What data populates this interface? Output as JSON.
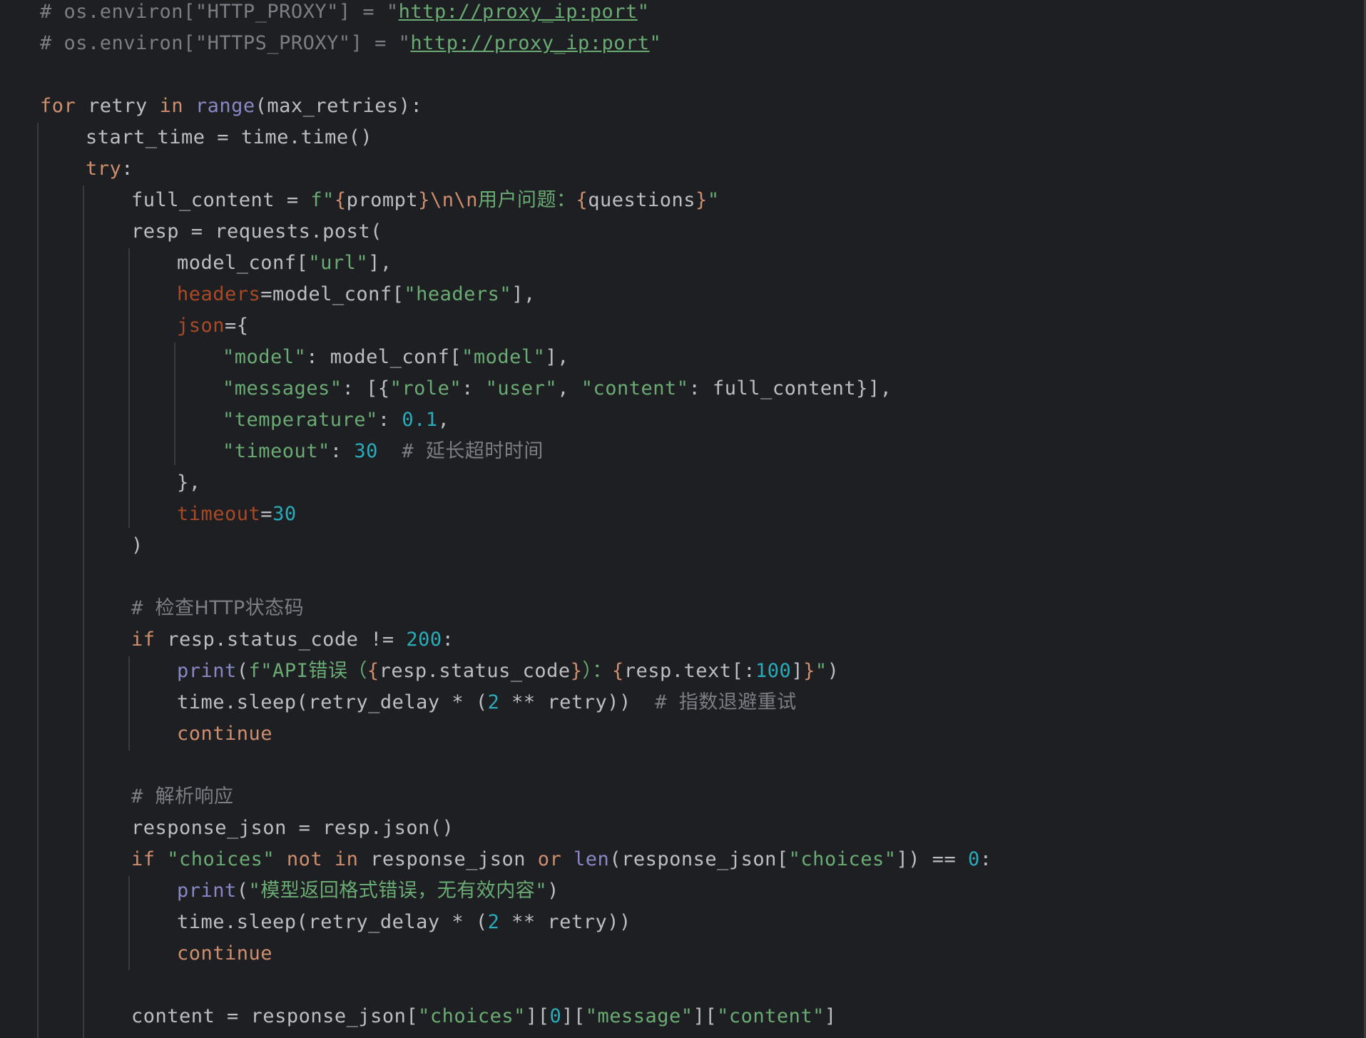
{
  "colors": {
    "background": "#1e1f22",
    "text": "#bcbec4",
    "comment": "#7a7e85",
    "keyword": "#cf8e6d",
    "builtin": "#8888c6",
    "string": "#6aab73",
    "number": "#2aacb8",
    "parameter": "#aa4926",
    "indent_guide": "#393b40"
  },
  "code": {
    "l1": {
      "a": "# os.environ[\"HTTP_PROXY\"] = \"",
      "b": "http://proxy_ip:port",
      "c": "\""
    },
    "l2": {
      "a": "# os.environ[\"HTTPS_PROXY\"] = \"",
      "b": "http://proxy_ip:port",
      "c": "\""
    },
    "l4": {
      "a": "for",
      "b": " retry ",
      "c": "in",
      "d": " ",
      "e": "range",
      "f": "(max_retries):"
    },
    "l5": {
      "a": "start_time = time.time()"
    },
    "l6": {
      "a": "try",
      "b": ":"
    },
    "l7": {
      "a": "full_content = ",
      "b": "f\"",
      "c": "{",
      "d": "prompt",
      "e": "}",
      "f": "\\n\\n",
      "g": "用户问题：",
      "h": "{",
      "i": "questions",
      "j": "}",
      "k": "\""
    },
    "l8": {
      "a": "resp = requests.post("
    },
    "l9": {
      "a": "model_conf[",
      "b": "\"url\"",
      "c": "],"
    },
    "l10": {
      "a": "headers",
      "b": "=model_conf[",
      "c": "\"headers\"",
      "d": "],"
    },
    "l11": {
      "a": "json",
      "b": "={"
    },
    "l12": {
      "a": "\"model\"",
      "b": ": model_conf[",
      "c": "\"model\"",
      "d": "],"
    },
    "l13": {
      "a": "\"messages\"",
      "b": ": [{",
      "c": "\"role\"",
      "d": ": ",
      "e": "\"user\"",
      "f": ", ",
      "g": "\"content\"",
      "h": ": full_content}],"
    },
    "l14": {
      "a": "\"temperature\"",
      "b": ": ",
      "c": "0.1",
      "d": ","
    },
    "l15": {
      "a": "\"timeout\"",
      "b": ": ",
      "c": "30",
      "d": "  # ",
      "e": "延长超时时间"
    },
    "l16": {
      "a": "},"
    },
    "l17": {
      "a": "timeout",
      "b": "=",
      "c": "30"
    },
    "l18": {
      "a": ")"
    },
    "l20": {
      "a": "# ",
      "b": "检查HTTP状态码"
    },
    "l21": {
      "a": "if",
      "b": " resp.status_code != ",
      "c": "200",
      "d": ":"
    },
    "l22": {
      "a": "print",
      "b": "(",
      "c": "f\"API",
      "d": "错误（",
      "e": "{",
      "f": "resp.status_code",
      "g": "}",
      "h": "）：",
      "i": "{",
      "j": "resp.text[:",
      "k": "100",
      "l": "]",
      "m": "}",
      "n": "\"",
      "o": ")"
    },
    "l23": {
      "a": "time.sleep(retry_delay * (",
      "b": "2",
      "c": " ** retry))  ",
      "d": "# ",
      "e": "指数退避重试"
    },
    "l24": {
      "a": "continue"
    },
    "l26": {
      "a": "# ",
      "b": "解析响应"
    },
    "l27": {
      "a": "response_json = resp.json()"
    },
    "l28": {
      "a": "if",
      "b": " ",
      "c": "\"choices\"",
      "d": " ",
      "e": "not",
      "f": " ",
      "g": "in",
      "h": " response_json ",
      "i": "or",
      "j": " ",
      "k": "len",
      "l": "(response_json[",
      "m": "\"choices\"",
      "n": "]) == ",
      "o": "0",
      "p": ":"
    },
    "l29": {
      "a": "print",
      "b": "(",
      "c": "\"",
      "d": "模型返回格式错误，无有效内容",
      "e": "\"",
      "f": ")"
    },
    "l30": {
      "a": "time.sleep(retry_delay * (",
      "b": "2",
      "c": " ** retry))"
    },
    "l31": {
      "a": "continue"
    },
    "l33": {
      "a": "content = response_json[",
      "b": "\"choices\"",
      "c": "][",
      "d": "0",
      "e": "][",
      "f": "\"message\"",
      "g": "][",
      "h": "\"content\"",
      "i": "]"
    }
  }
}
